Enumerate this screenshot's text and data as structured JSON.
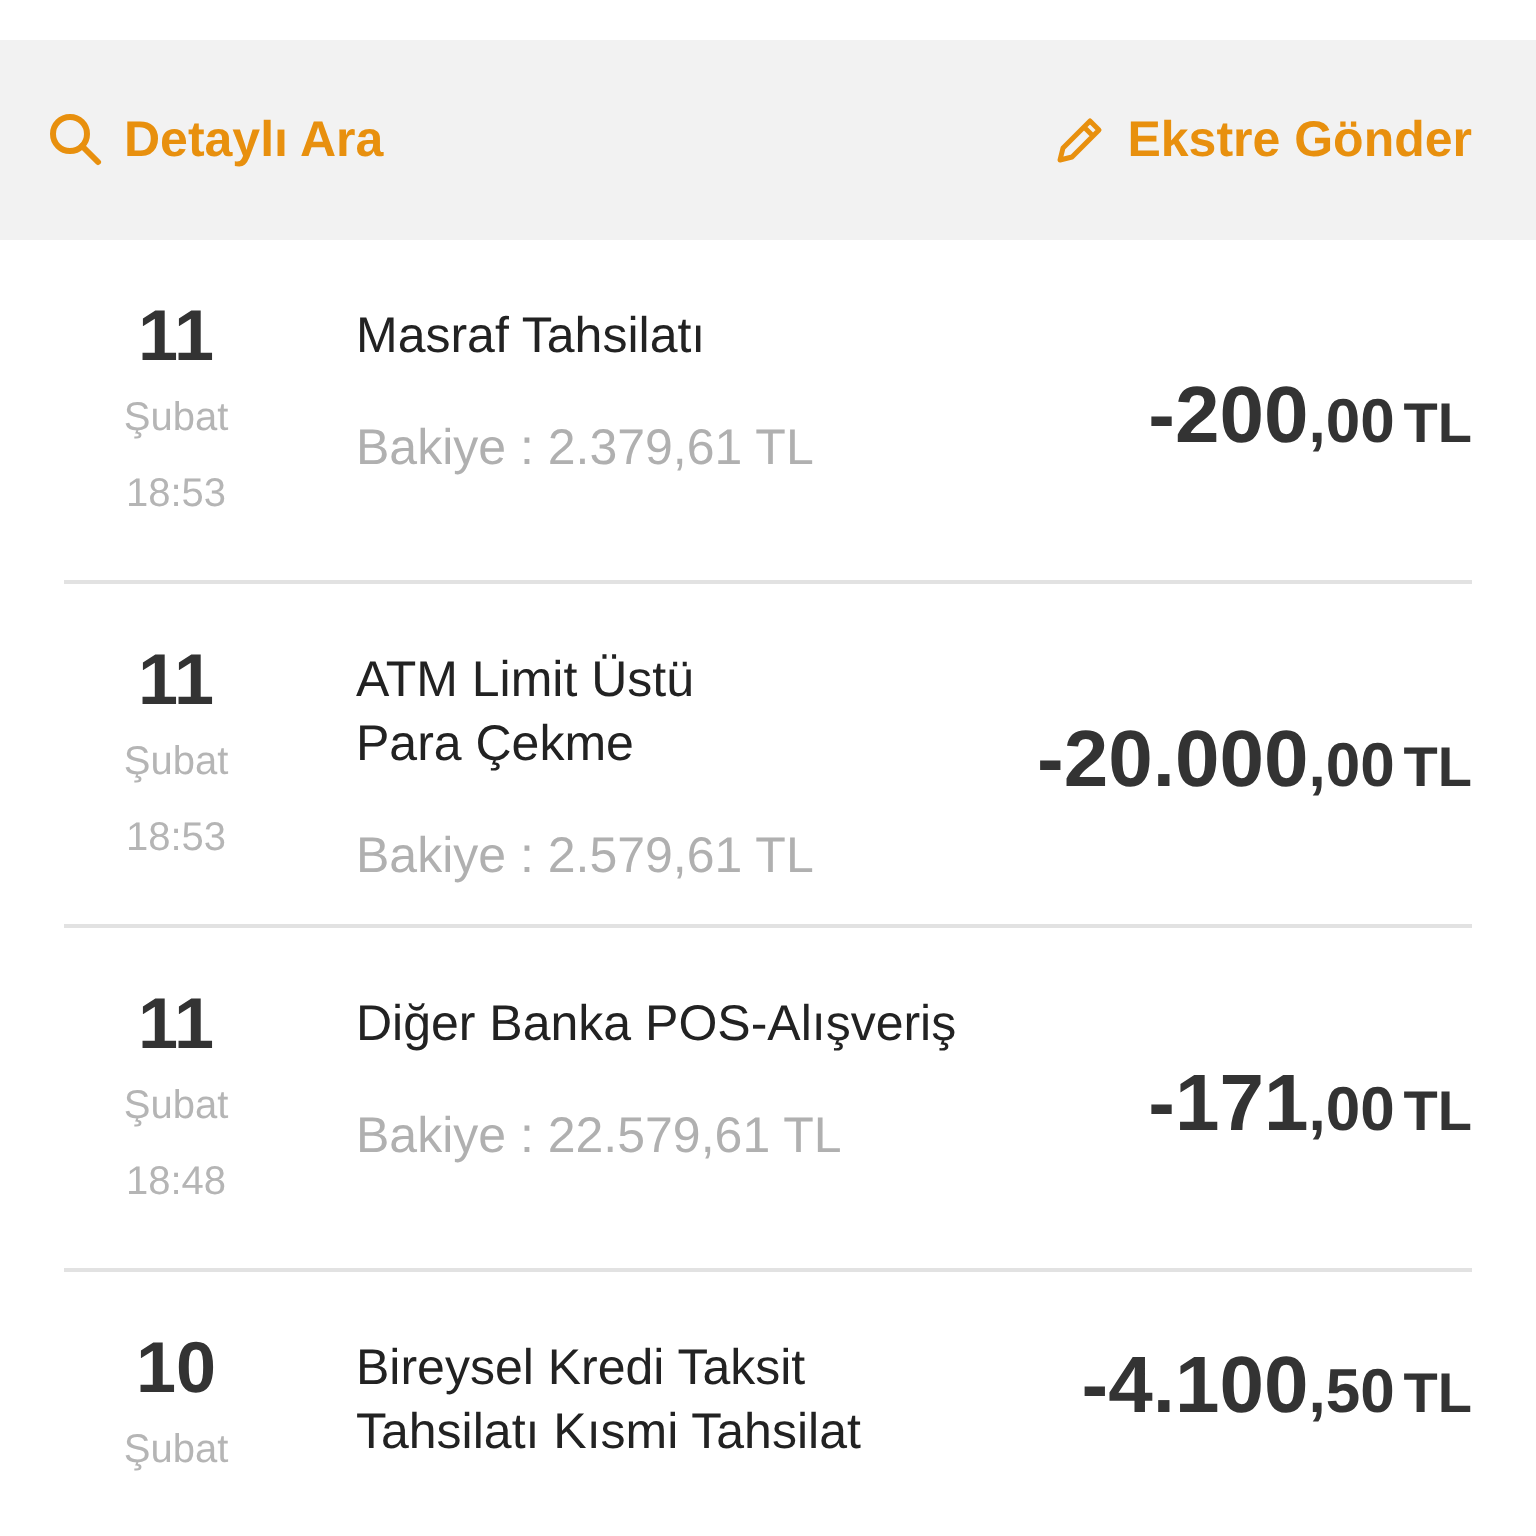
{
  "toolbar": {
    "search_link": "Detaylı Ara",
    "statement_link": "Ekstre Gönder"
  },
  "transactions": [
    {
      "day": "11",
      "month": "Şubat",
      "time": "18:53",
      "title": "Masraf Tahsilatı",
      "balance": "Bakiye : 2.379,61 TL",
      "amount_main": "-200",
      "amount_fraction": ",00",
      "currency": "TL"
    },
    {
      "day": "11",
      "month": "Şubat",
      "time": "18:53",
      "title": "ATM Limit Üstü\nPara Çekme",
      "balance": "Bakiye : 2.579,61 TL",
      "amount_main": "-20.000",
      "amount_fraction": ",00",
      "currency": "TL"
    },
    {
      "day": "11",
      "month": "Şubat",
      "time": "18:48",
      "title": "Diğer Banka POS-Alışveriş",
      "balance": "Bakiye : 22.579,61 TL",
      "amount_main": "-171",
      "amount_fraction": ",00",
      "currency": "TL"
    },
    {
      "day": "10",
      "month": "Şubat",
      "title": "Bireysel Kredi Taksit\nTahsilatı Kısmi Tahsilat",
      "amount_main": "-4.100",
      "amount_fraction": ",50",
      "currency": "TL"
    }
  ]
}
